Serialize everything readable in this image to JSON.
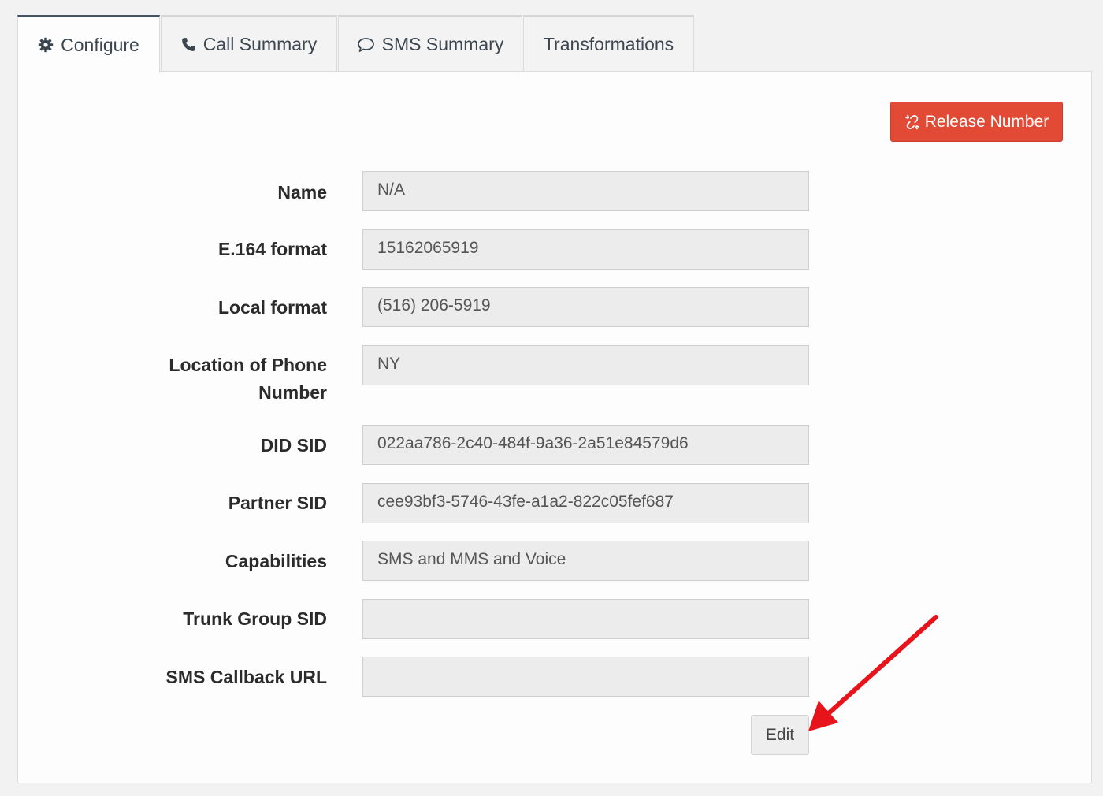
{
  "tabs": [
    {
      "label": "Configure",
      "icon": "gear-icon",
      "active": true
    },
    {
      "label": "Call Summary",
      "icon": "phone-icon",
      "active": false
    },
    {
      "label": "SMS Summary",
      "icon": "chat-bubble-icon",
      "active": false
    },
    {
      "label": "Transformations",
      "icon": "",
      "active": false
    }
  ],
  "actions": {
    "release_label": "Release Number",
    "release_icon": "unlink-icon",
    "edit_label": "Edit"
  },
  "fields": {
    "name": {
      "label": "Name",
      "value": "N/A"
    },
    "e164": {
      "label": "E.164 format",
      "value": "15162065919"
    },
    "local": {
      "label": "Local format",
      "value": "(516) 206-5919"
    },
    "location": {
      "label": "Location of Phone Number",
      "value": "NY"
    },
    "did_sid": {
      "label": "DID SID",
      "value": "022aa786-2c40-484f-9a36-2a51e84579d6"
    },
    "partner_sid": {
      "label": "Partner SID",
      "value": "cee93bf3-5746-43fe-a1a2-822c05fef687"
    },
    "capabilities": {
      "label": "Capabilities",
      "value": "SMS and MMS and Voice"
    },
    "trunk_group_sid": {
      "label": "Trunk Group SID",
      "value": ""
    },
    "sms_callback_url": {
      "label": "SMS Callback URL",
      "value": ""
    }
  },
  "colors": {
    "release_button": "#e34a35",
    "active_tab_border": "#44535f",
    "annotation_arrow": "#e8141c"
  }
}
